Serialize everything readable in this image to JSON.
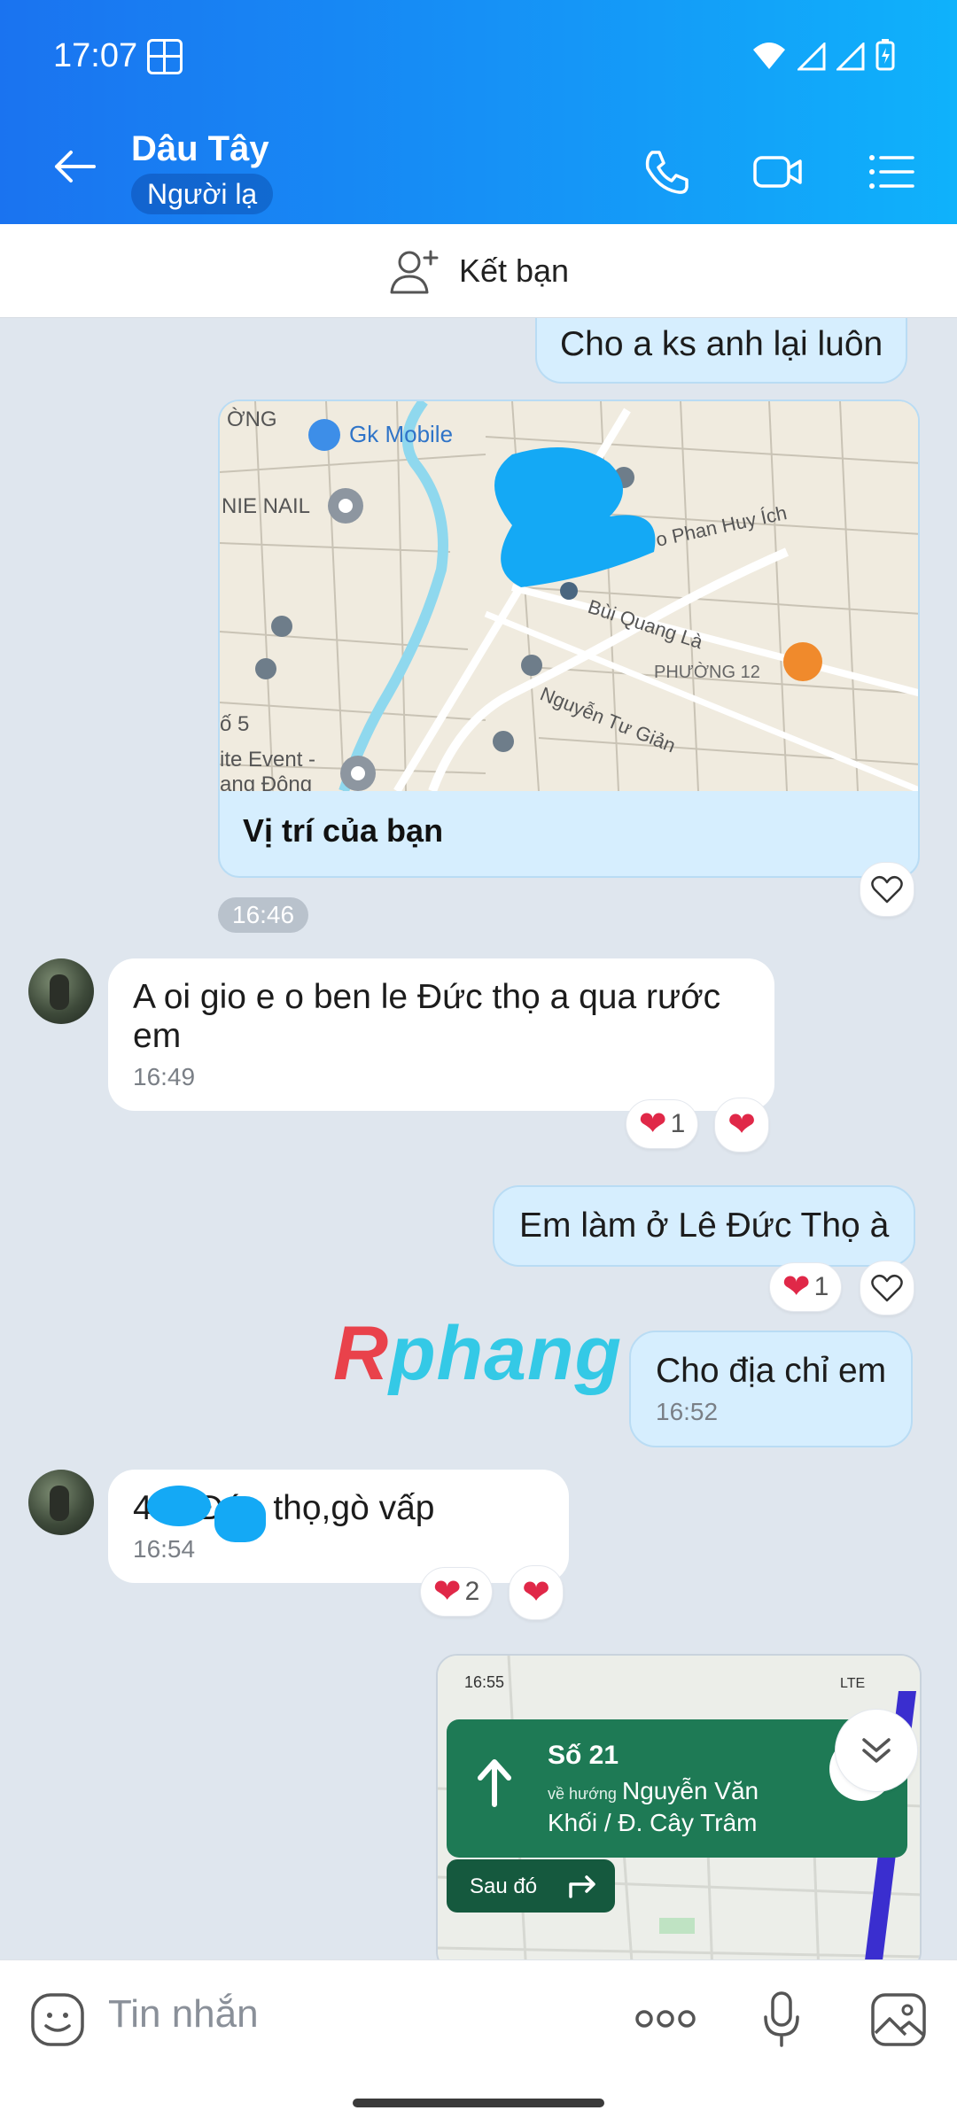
{
  "status": {
    "time": "17:07"
  },
  "header": {
    "contact_name": "Dâu Tây",
    "badge": "Người lạ"
  },
  "friend_bar": {
    "label": "Kết bạn"
  },
  "messages": {
    "m1": {
      "text": "Cho a ks anh lại luôn"
    },
    "location": {
      "label": "Vị trí của bạn",
      "time": "16:46",
      "map_text": {
        "gk": "Gk Mobile",
        "nail": "NIE NAIL",
        "ward": "PHƯỜNG 12",
        "street1": "o Phan Huy Ích",
        "street2": "Bùi Quang Là",
        "street3": "Nguyễn Tư Giản",
        "edge1": "ỜNG",
        "edge2": "ố 5",
        "edge3": "ite Event -",
        "edge4": "ạng Đông"
      }
    },
    "m2": {
      "text": "A oi gio e o ben le Đức thọ a qua rước em",
      "time": "16:49",
      "reaction_count": "1"
    },
    "m3": {
      "text": "Em làm ở Lê Đức Thọ à",
      "reaction_count": "1"
    },
    "m4": {
      "text": "Cho địa chỉ em",
      "time": "16:52"
    },
    "m5": {
      "text": "4 lê Đức thọ,gò vấp",
      "time": "16:54",
      "reaction_count": "2"
    },
    "nav_shot": {
      "status_time": "16:55",
      "network": "LTE",
      "street_num": "Số 21",
      "toward": "về hướng",
      "destination_line1": "Nguyễn Văn",
      "destination_line2": "Khối / Đ. Cây Trâm",
      "then": "Sau đó"
    }
  },
  "watermark": {
    "r": "R",
    "rest": "phang"
  },
  "input": {
    "placeholder": "Tin nhắn"
  },
  "colors": {
    "header_start": "#1a73f0",
    "header_end": "#0fb2fb",
    "bubble_out": "#d6eefe",
    "heart": "#e02848",
    "nav_green": "#1e7a55"
  }
}
